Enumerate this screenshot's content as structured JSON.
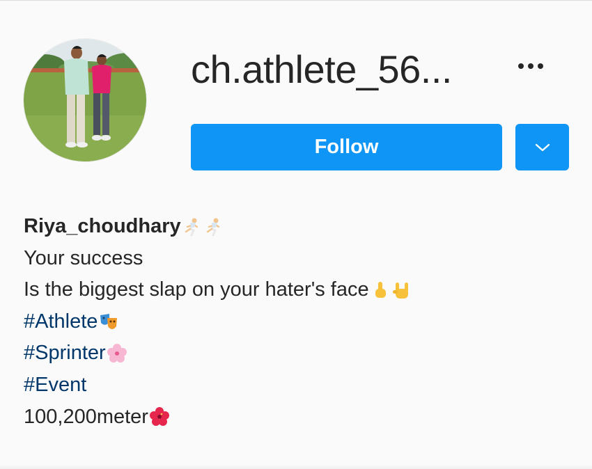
{
  "profile": {
    "username": "ch.athlete_56...",
    "follow_label": "Follow",
    "more_icon": "ellipsis-icon",
    "dropdown_icon": "chevron-down-icon",
    "accent_color": "#0f95f6"
  },
  "bio": {
    "name": "Riya_choudhary",
    "line1": "Your success",
    "line2": "Is the biggest slap on your hater's face",
    "hashtag1": "#Athlete",
    "hashtag2": "#Sprinter",
    "hashtag3": "#Event",
    "line3": "100,200meter",
    "link_color": "#00376b"
  }
}
